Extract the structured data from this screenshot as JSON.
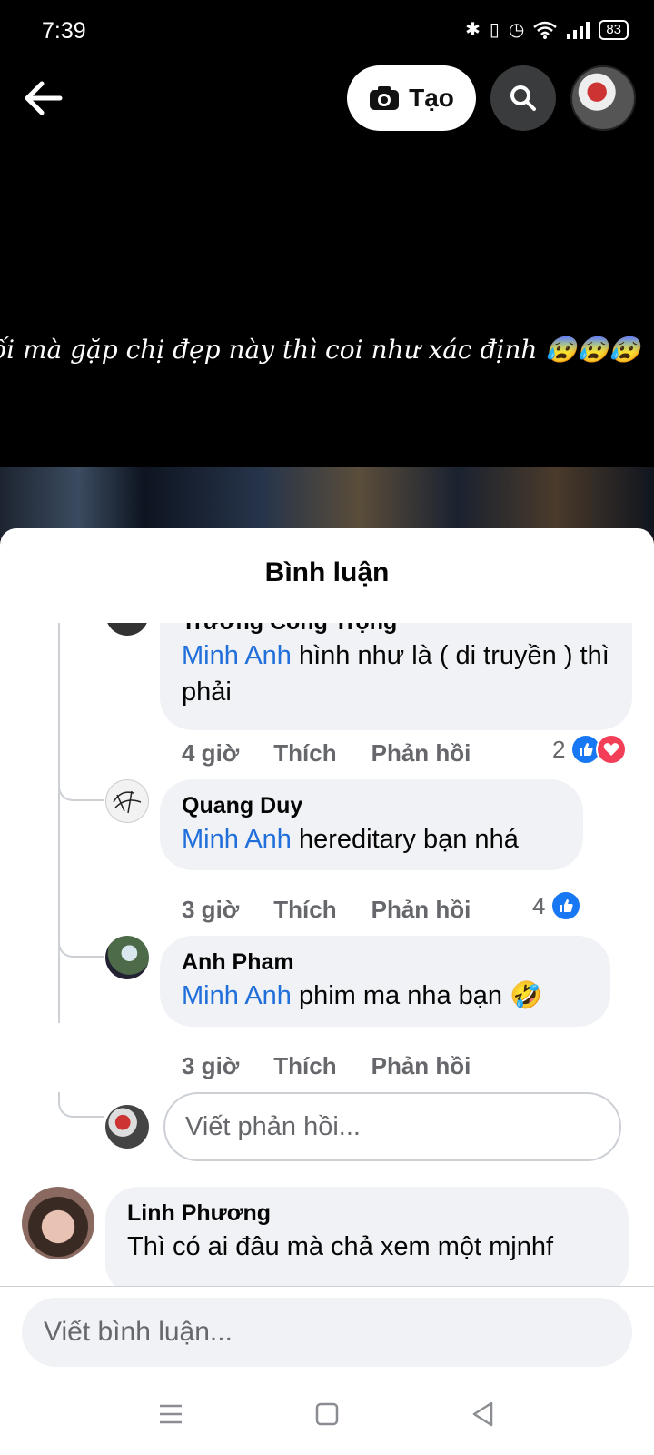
{
  "status_bar": {
    "time": "7:39",
    "battery": "83"
  },
  "header": {
    "create_label": "Tạo"
  },
  "video": {
    "caption": "ối mà gặp chị đẹp này thì coi như xác định 😰😰😰"
  },
  "sheet": {
    "title": "Bình luận"
  },
  "replies": [
    {
      "author": "Trương Công Trọng",
      "mention": "Minh Anh",
      "text": " hình như là ( di truyền ) thì phải",
      "time": "4 giờ",
      "like": "Thích",
      "reply": "Phản hồi",
      "reaction_count": "2"
    },
    {
      "author": "Quang Duy",
      "mention": "Minh Anh",
      "text": " hereditary bạn nhá",
      "time": "3 giờ",
      "like": "Thích",
      "reply": "Phản hồi",
      "reaction_count": "4"
    },
    {
      "author": "Anh Pham",
      "mention": "Minh Anh",
      "text": " phim ma nha bạn 🤣",
      "time": "3 giờ",
      "like": "Thích",
      "reply": "Phản hồi"
    }
  ],
  "reply_input": {
    "placeholder": "Viết phản hồi..."
  },
  "comment": {
    "author": "Linh Phương",
    "text": "Thì có ai đâu mà chả xem một mjnhf"
  },
  "comment_input": {
    "placeholder": "Viết bình luận..."
  },
  "colors": {
    "mention": "#216fdb",
    "bubble": "#f0f2f5",
    "like": "#1877f2",
    "love": "#f33e58"
  }
}
